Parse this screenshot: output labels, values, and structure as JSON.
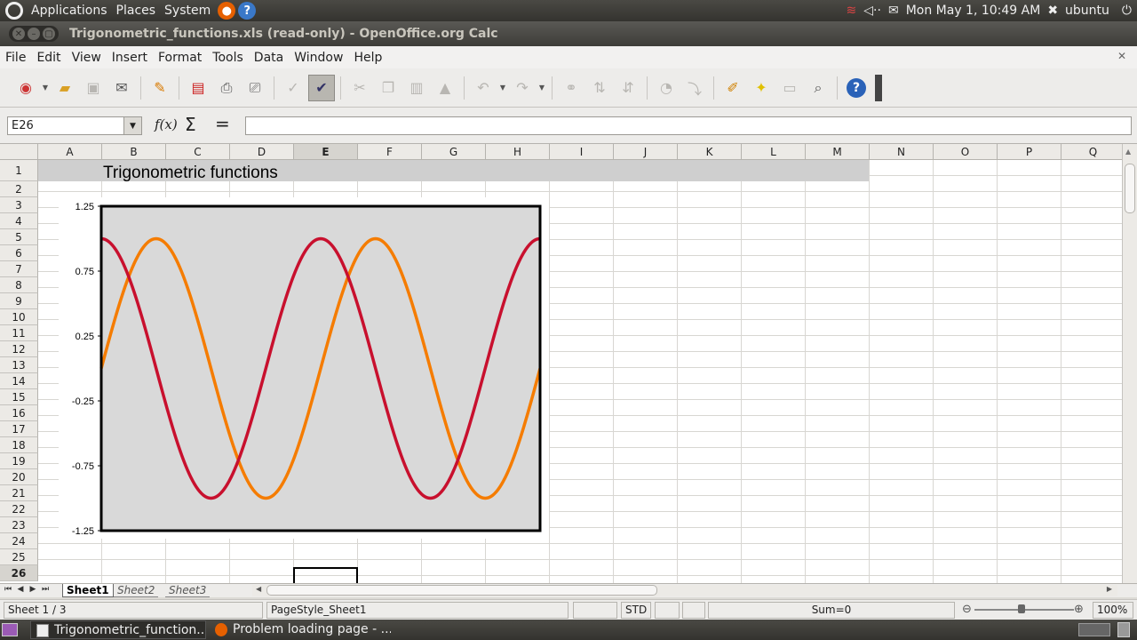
{
  "top_panel": {
    "menus": [
      "Applications",
      "Places",
      "System"
    ],
    "clock": "Mon May  1, 10:49 AM",
    "user": "ubuntu"
  },
  "window": {
    "title": "Trigonometric_functions.xls (read-only) - OpenOffice.org Calc"
  },
  "menubar": {
    "items": [
      "File",
      "Edit",
      "View",
      "Insert",
      "Format",
      "Tools",
      "Data",
      "Window",
      "Help"
    ]
  },
  "toolbar": {
    "icons": [
      "new-icon",
      "open-icon",
      "save-icon",
      "email-icon",
      "edit-file-icon",
      "export-pdf-icon",
      "print-icon",
      "print-preview-icon",
      "spellcheck-icon",
      "autospellcheck-icon",
      "cut-icon",
      "copy-icon",
      "paste-icon",
      "format-paintbrush-icon",
      "undo-icon",
      "redo-icon",
      "hyperlink-icon",
      "sort-ascending-icon",
      "sort-descending-icon",
      "chart-icon",
      "draw-functions-icon",
      "navigator-icon",
      "gallery-icon",
      "zoom-icon",
      "help-icon"
    ]
  },
  "formula_bar": {
    "cell_ref": "E26",
    "fx": "f(x)",
    "sum": "Σ",
    "equal": "=",
    "formula": ""
  },
  "sheet": {
    "columns": [
      "A",
      "B",
      "C",
      "D",
      "E",
      "F",
      "G",
      "H",
      "I",
      "J",
      "K",
      "L",
      "M",
      "N",
      "O",
      "P",
      "Q"
    ],
    "rows": [
      "1",
      "2",
      "3",
      "4",
      "5",
      "6",
      "7",
      "8",
      "9",
      "10",
      "11",
      "12",
      "13",
      "14",
      "15",
      "16",
      "17",
      "18",
      "19",
      "20",
      "21",
      "22",
      "23",
      "24",
      "25",
      "26"
    ],
    "selected_column": "E",
    "selected_row": "26",
    "title": "Trigonometric functions"
  },
  "chart_data": {
    "type": "line",
    "title": "",
    "xlabel": "",
    "ylabel": "",
    "ylim": [
      -1.25,
      1.25
    ],
    "yticks": [
      "1.25",
      "0.75",
      "0.25",
      "-0.25",
      "-0.75",
      "-1.25"
    ],
    "yticks_values": [
      1.25,
      0.75,
      0.25,
      -0.25,
      -0.75,
      -1.25
    ],
    "xlim": [
      0,
      12.566
    ],
    "grid": false,
    "background": "#d9d9d9",
    "series": [
      {
        "function": "sin(x)",
        "color": "#f57c00"
      },
      {
        "function": "cos(x)",
        "color": "#c8102e"
      }
    ]
  },
  "tabs": {
    "sheets": [
      "Sheet1",
      "Sheet2",
      "Sheet3"
    ],
    "active": "Sheet1"
  },
  "statusbar": {
    "sheet_info": "Sheet 1 / 3",
    "page_style": "PageStyle_Sheet1",
    "mode": "STD",
    "sum": "Sum=0",
    "zoom": "100%"
  },
  "taskbar": {
    "tasks": [
      "Trigonometric_function...",
      "Problem loading page - ..."
    ]
  }
}
